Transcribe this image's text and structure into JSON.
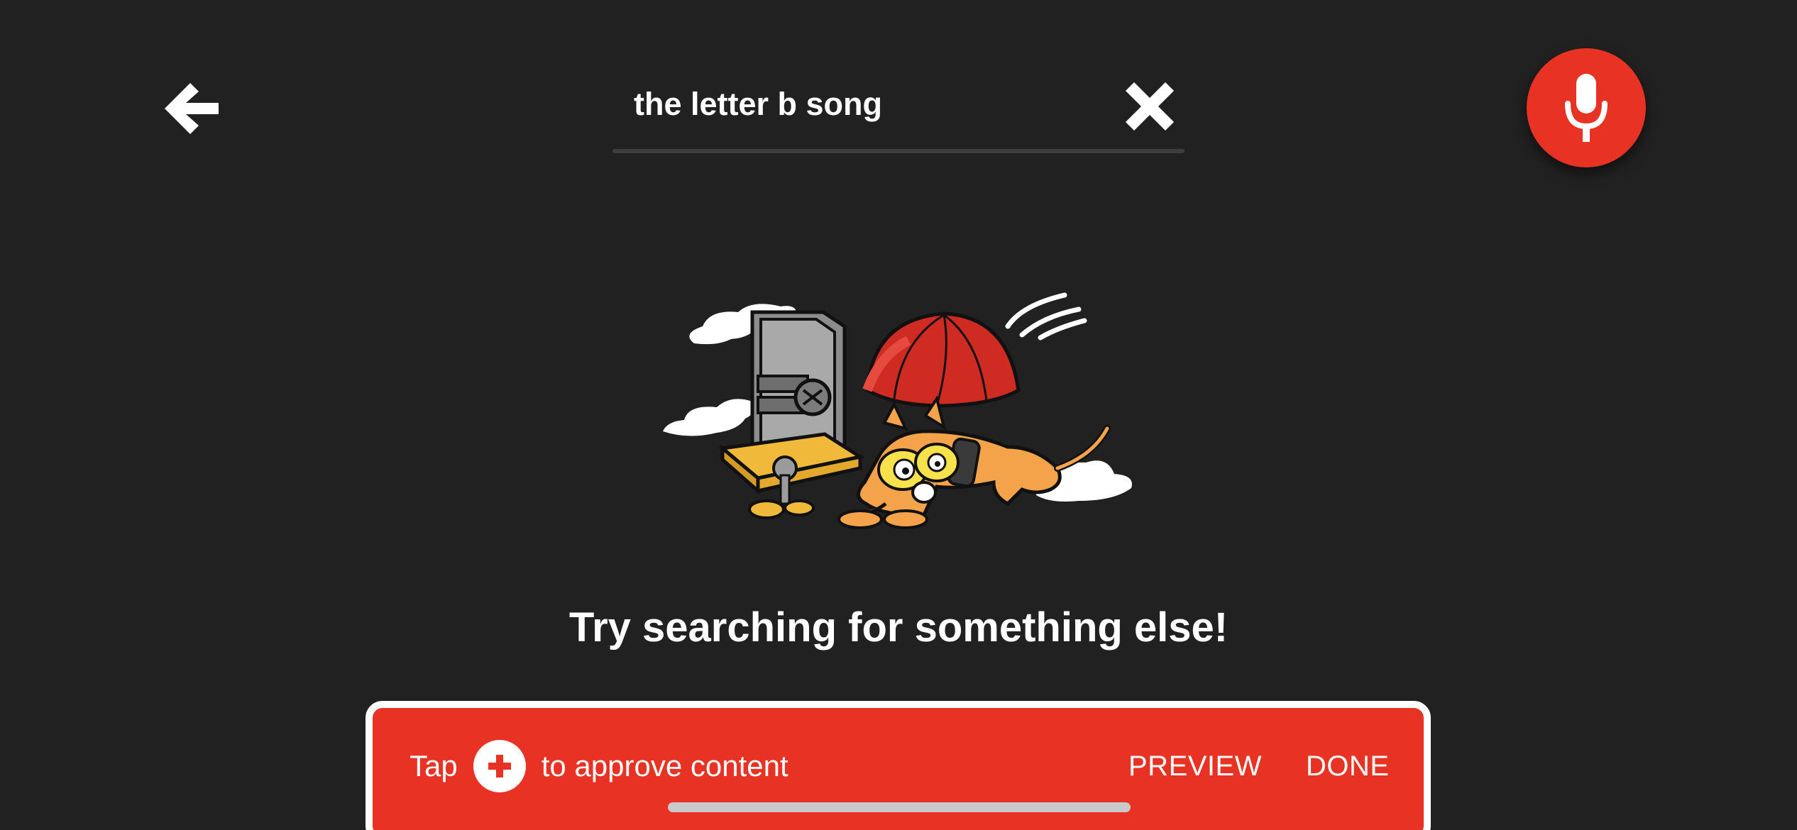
{
  "header": {
    "back_icon": "arrow-left-icon",
    "clear_icon": "close-icon",
    "mic_icon": "microphone-icon"
  },
  "search": {
    "value": "the letter b song",
    "placeholder": ""
  },
  "empty_state": {
    "illustration": "safe-and-parachuting-cat-illustration",
    "message": "Try searching for something else!"
  },
  "approve_bar": {
    "prefix": "Tap",
    "plus_icon": "plus-icon",
    "suffix": "to approve content",
    "preview_label": "PREVIEW",
    "done_label": "DONE"
  },
  "colors": {
    "background": "#212121",
    "accent_red": "#e83224",
    "text": "#ffffff",
    "underline": "#3d3d3d"
  }
}
